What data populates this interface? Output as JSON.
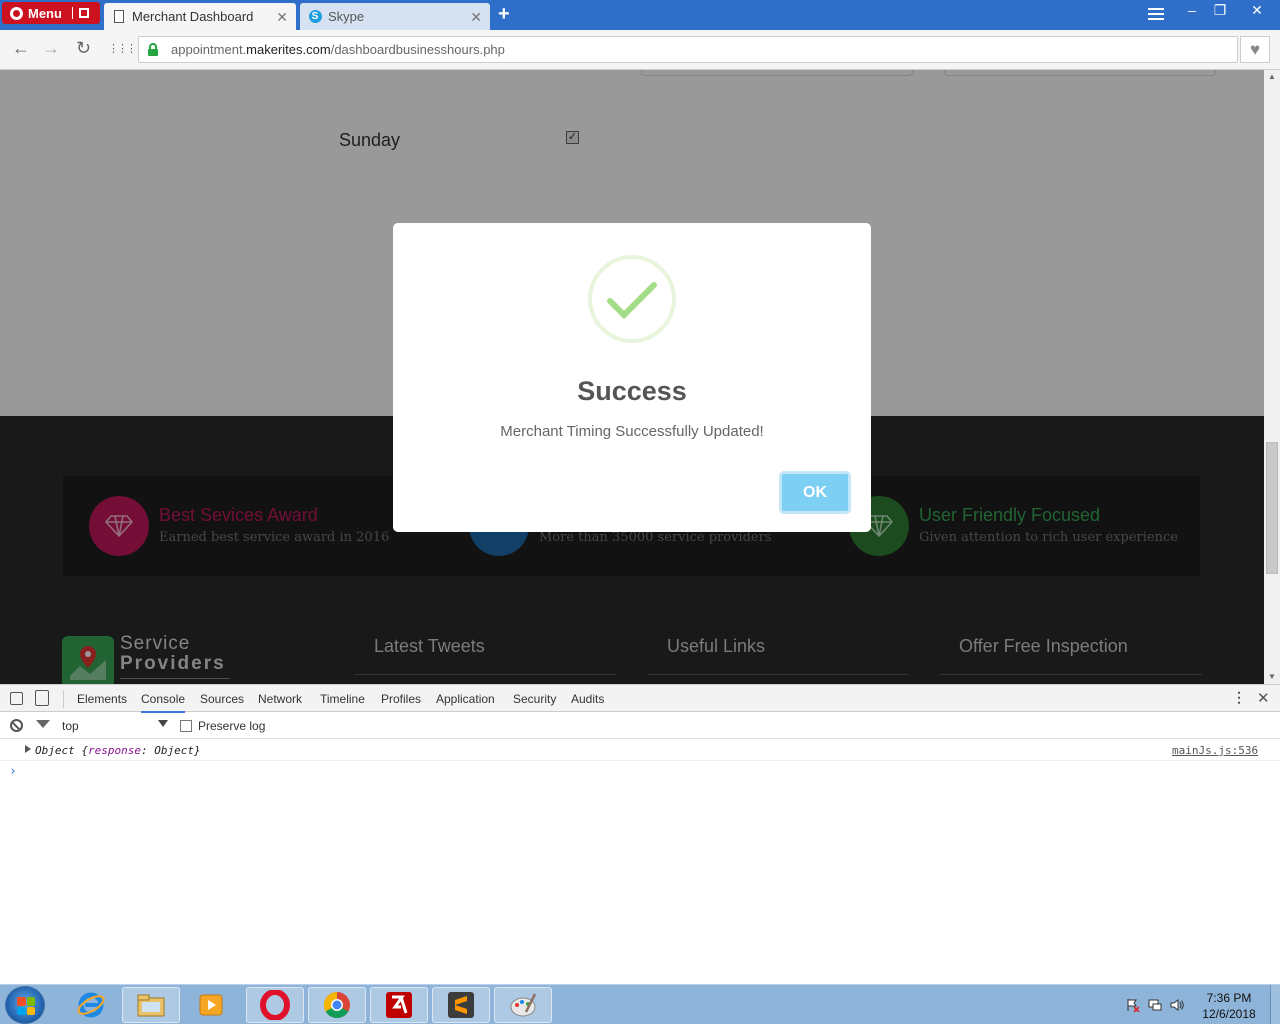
{
  "browser": {
    "menu_label": "Menu",
    "tabs": [
      {
        "label": "Merchant Dashboard",
        "icon": "document-icon",
        "close": "✕"
      },
      {
        "label": "Skype",
        "icon": "skype-icon",
        "close": "✕"
      }
    ],
    "new_tab": "+",
    "window_controls": {
      "minimize": "–",
      "maximize": "❐",
      "close": "✕"
    },
    "url": {
      "prefix": "appointment.",
      "host": "makerites.com",
      "path": "/dashboardbusinesshours.php"
    },
    "nav": {
      "back": "←",
      "forward": "→",
      "reload": "↻",
      "speed_dial": "⋮⋮⋮",
      "bookmark": "♥"
    }
  },
  "page": {
    "sunday": {
      "label": "Sunday",
      "checked": true,
      "check_mark": "✓"
    },
    "awards": [
      {
        "title": "Best Sevices Award",
        "subtitle": "Earned best service award in 2016",
        "color": "#c2185b"
      },
      {
        "title": "",
        "subtitle": "More than 35000 service providers",
        "color": "#1e6aa8"
      },
      {
        "title": "User Friendly Focused",
        "subtitle": "Given attention to rich user experience",
        "color": "#2e7d32"
      }
    ],
    "footer": {
      "brand_line1": "Service",
      "brand_line2": "Providers",
      "headings": [
        "Latest Tweets",
        "Useful Links",
        "Offer Free Inspection"
      ]
    }
  },
  "dialog": {
    "title": "Success",
    "message": "Merchant Timing Successfully Updated!",
    "ok_label": "OK",
    "accent": "#a5dc86"
  },
  "devtools": {
    "tabs": [
      "Elements",
      "Console",
      "Sources",
      "Network",
      "Timeline",
      "Profiles",
      "Application",
      "Security",
      "Audits"
    ],
    "active_tab": "Console",
    "context": "top",
    "preserve_log_label": "Preserve log",
    "log": {
      "prefix": "Object ",
      "open": "{",
      "key": "response",
      "rest": ": Object}",
      "source": "mainJs.js:536"
    },
    "prompt": "›"
  },
  "taskbar": {
    "apps": [
      "internet-explorer",
      "file-explorer",
      "media-player",
      "opera",
      "chrome",
      "filezilla",
      "sublime-text",
      "paint"
    ],
    "clock_time": "7:36 PM",
    "clock_date": "12/6/2018"
  }
}
